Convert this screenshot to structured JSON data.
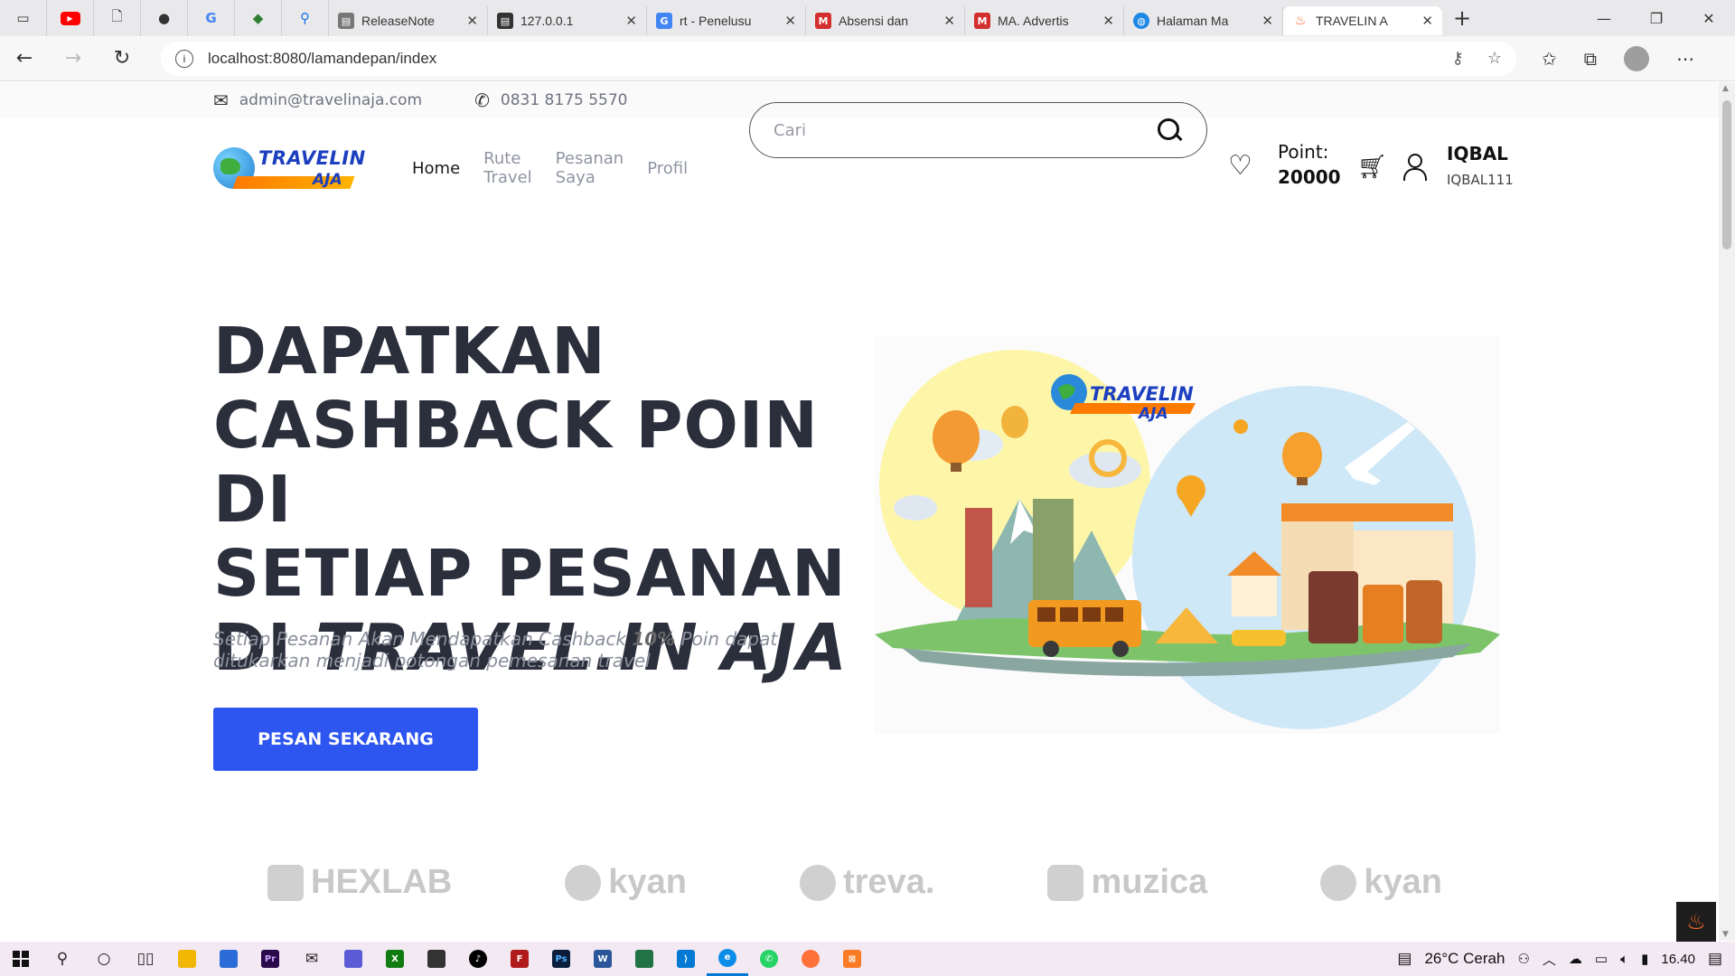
{
  "browser": {
    "tabs": [
      {
        "title": "ReleaseNote",
        "favicon_color": "#5a5a5a",
        "favicon": "doc"
      },
      {
        "title": "127.0.0.1",
        "favicon_color": "#333333",
        "favicon": "doc"
      },
      {
        "title": "rt - Penelusu",
        "favicon_color": "#4285f4",
        "favicon": "G"
      },
      {
        "title": "Absensi dan",
        "favicon_color": "#d32f2f",
        "favicon": "M"
      },
      {
        "title": "MA. Advertis",
        "favicon_color": "#d32f2f",
        "favicon": "M"
      },
      {
        "title": "Halaman Ma",
        "favicon_color": "#1e88e5",
        "favicon": "globe"
      },
      {
        "title": "TRAVELIN A",
        "favicon_color": "#ff5722",
        "favicon": "fire"
      }
    ],
    "url": "localhost:8080/lamandepan/index"
  },
  "topbar": {
    "email": "admin@travelinaja.com",
    "phone": "0831 8175 5570"
  },
  "logo": {
    "line1": "TRAVELIN",
    "line2": "AJA"
  },
  "nav": {
    "home": "Home",
    "rute_line1": "Rute",
    "rute_line2": "Travel",
    "pesanan_line1": "Pesanan",
    "pesanan_line2": "Saya",
    "profil": "Profil"
  },
  "search": {
    "placeholder": "Cari"
  },
  "points": {
    "label": "Point:",
    "value": "20000"
  },
  "user": {
    "name": "IQBAL",
    "username": "IQBAL111"
  },
  "hero": {
    "title_line1": "DAPATKAN",
    "title_line2": "CASHBACK POIN DI",
    "title_line3": "SETIAP PESANAN",
    "title_line4_prefix": "DI ",
    "title_line4_brand": "TRAVEL.IN AJA",
    "subtitle_part1": "Setiap Pesanan Akan Mendapatkan Cashback ",
    "subtitle_bold": "10%",
    "subtitle_part2": " Poin dapat ditukarkan menjadi potongan pemesanan travel",
    "cta": "PESAN SEKARANG"
  },
  "illustration": {
    "logo_line1": "TRAVELIN",
    "logo_line2": "AJA"
  },
  "partners": [
    "HEXLAB",
    "kyan",
    "treva.",
    "muzica",
    "kyan"
  ],
  "taskbar": {
    "weather": "26°C Cerah",
    "time": "16.40"
  },
  "colors": {
    "primary": "#2d55ef",
    "heading": "#2b2f3c",
    "logo_blue": "#1c3fbf",
    "logo_orange": "#ff7a00"
  }
}
